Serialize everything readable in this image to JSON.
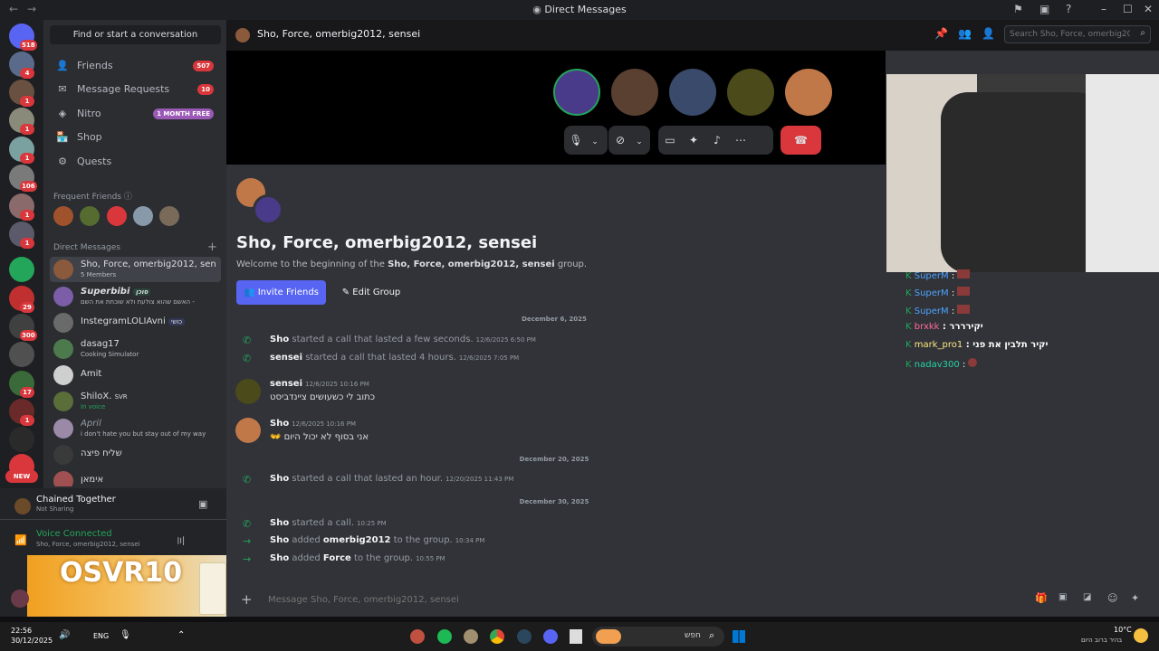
{
  "window": {
    "title": "Direct Messages"
  },
  "servers": [
    {
      "badge": "518"
    },
    {
      "badge": "4"
    },
    {
      "badge": "1"
    },
    {
      "badge": "1"
    },
    {
      "badge": "1"
    },
    {
      "badge": "106"
    },
    {
      "badge": "1"
    },
    {
      "badge": "1"
    },
    {
      "badge": ""
    },
    {
      "badge": "29"
    },
    {
      "badge": "300"
    },
    {
      "badge": ""
    },
    {
      "badge": "17"
    },
    {
      "badge": "1"
    },
    {
      "badge": ""
    },
    {
      "badge": "NEW"
    }
  ],
  "sidebar": {
    "find": "Find or start a conversation",
    "nav": [
      {
        "label": "Friends",
        "badge": "507"
      },
      {
        "label": "Message Requests",
        "badge": "10"
      },
      {
        "label": "Nitro",
        "badge": "1 MONTH FREE"
      },
      {
        "label": "Shop",
        "badge": ""
      },
      {
        "label": "Quests",
        "badge": ""
      }
    ],
    "frequent_header": "Frequent Friends",
    "dm_header": "Direct Messages",
    "dms": [
      {
        "name": "Sho, Force, omerbig2012, sen...",
        "sub": "5 Members"
      },
      {
        "name": "Superbibi",
        "tag": "סוכן",
        "sub": "האשם שהוא צולעת ולא שוכחת את השם -"
      },
      {
        "name": "InstegramLOLIAvni",
        "tag": "כושי",
        "sub": ""
      },
      {
        "name": "dasag17",
        "sub": "Cooking Simulator"
      },
      {
        "name": "Amit",
        "sub": ""
      },
      {
        "name": "ShiloX.",
        "tag": "SVR",
        "sub": "In voice"
      },
      {
        "name": "April",
        "sub": "i don't hate you but stay out of my way"
      },
      {
        "name": "שליח פיצה",
        "sub": ""
      },
      {
        "name": "אימאן",
        "sub": ""
      }
    ]
  },
  "user_panel": {
    "activity_title": "Chained Together",
    "activity_sub": "Not Sharing",
    "voice_status": "Voice Connected",
    "voice_channel": "Sho, Force, omerbig2012, sensei",
    "ad_text": "OSVR10"
  },
  "header": {
    "title": "Sho, Force, omerbig2012, sensei",
    "search_placeholder": "Search Sho, Force, omerbig2012,..."
  },
  "welcome": {
    "title": "Sho, Force, omerbig2012, sensei",
    "line_prefix": "Welcome to the beginning of the ",
    "line_name": "Sho, Force, omerbig2012, sensei",
    "line_suffix": " group.",
    "invite_button": "Invite Friends",
    "edit_button": "Edit Group"
  },
  "messages": {
    "d1": "December 6, 2025",
    "c1": {
      "author": "Sho",
      "text": "started a call that lasted a few seconds.",
      "ts": "12/6/2025 6:50 PM"
    },
    "c2": {
      "author": "sensei",
      "text": "started a call that lasted 4 hours.",
      "ts": "12/6/2025 7:05 PM"
    },
    "m1": {
      "author": "sensei",
      "ts": "12/6/2025 10:16 PM",
      "text": "כתוב לי כשעושים ציינדביסט"
    },
    "m2": {
      "author": "Sho",
      "ts": "12/6/2025 10:16 PM",
      "text": "אני בסוף לא יכול היום"
    },
    "d2": "December 20, 2025",
    "c3": {
      "author": "Sho",
      "text": "started a call that lasted an hour.",
      "ts": "12/20/2025 11:43 PM"
    },
    "d3": "December 30, 2025",
    "c4": {
      "author": "Sho",
      "text": "started a call.",
      "ts": "10:25 PM"
    },
    "a1": {
      "author": "Sho",
      "verb": "added",
      "target": "omerbig2012",
      "rest": "to the group.",
      "ts": "10:34 PM"
    },
    "a2": {
      "author": "Sho",
      "verb": "added",
      "target": "Force",
      "rest": "to the group.",
      "ts": "10:55 PM"
    }
  },
  "composer": {
    "placeholder": "Message Sho, Force, omerbig2012, sensei"
  },
  "stream_chat": [
    {
      "name": "SuperM",
      "sep": " :"
    },
    {
      "name": "SuperM",
      "sep": " :"
    },
    {
      "name": "SuperM",
      "sep": " :"
    },
    {
      "name": "brxkk",
      "sep": " : יקירררר"
    },
    {
      "name": "mark_pro1",
      "sep": " : יקיר תלבין את פני"
    },
    {
      "name": "nadav300",
      "sep": " :"
    }
  ],
  "taskbar": {
    "time": "22:56",
    "date": "30/12/2025",
    "lang": "ENG",
    "search": "חפש",
    "weather_temp": "10°C",
    "weather_desc": "בהיר ברוב היום"
  },
  "colors": {
    "accent": "#5865f2",
    "danger": "#da373c",
    "online": "#23a55a",
    "nitro": "#9b59b6"
  }
}
